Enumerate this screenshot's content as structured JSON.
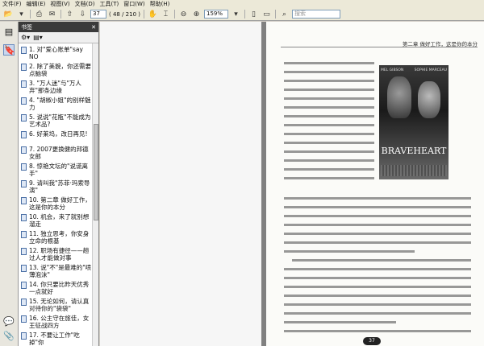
{
  "menu": [
    "文件(F)",
    "编辑(E)",
    "视图(V)",
    "文档(D)",
    "工具(T)",
    "窗口(W)",
    "帮助(H)"
  ],
  "toolbar": {
    "page_current": "37",
    "page_total": "( 48 / 210 )",
    "zoom": "159%",
    "search_placeholder": "搜索"
  },
  "panel": {
    "title": "书签",
    "bookmarks": [
      "1. 对\"爱心账单\"say NO",
      "2. 除了美貌，你还需要点脑袋",
      "3. \"万人迷\"与\"万人弃\"那条边缘",
      "4. \"胡椒小姐\"的别样魅力",
      "5. 说说\"花瓶\"不能成为艺术品?",
      "6. 好莱坞，改日再见!",
      "7. 2007更换健的邦德女郎",
      "8. 惊艳文坛的\"说谎离手\"",
      "9. 请叫我\"苏菲·玛索导演\"",
      "10. 第二章 做好工作，这是你的本分",
      "10. 机会，来了就别想溜走",
      "11. 独立思考，你安身立命的根基",
      "12. 职场有捷径——趟过人才能做对事",
      "13. 说\"不\"是最难的\"喷薄泡沫\"",
      "14. 你只要比昨天优秀一点就好",
      "15. 无论如何，请认真对待你的\"袋袋\"",
      "16. 公主守在旅佳，女王征战四方",
      "17. 不要让工作\"吃掉\"你"
    ]
  },
  "document": {
    "header": "第二章  做好工作，这是你的本分",
    "poster": {
      "actor_left": "MEL GIBSON",
      "actor_right": "SOPHIE MARCEAU",
      "title": "BRAVEHEART"
    },
    "page_number": "37"
  }
}
